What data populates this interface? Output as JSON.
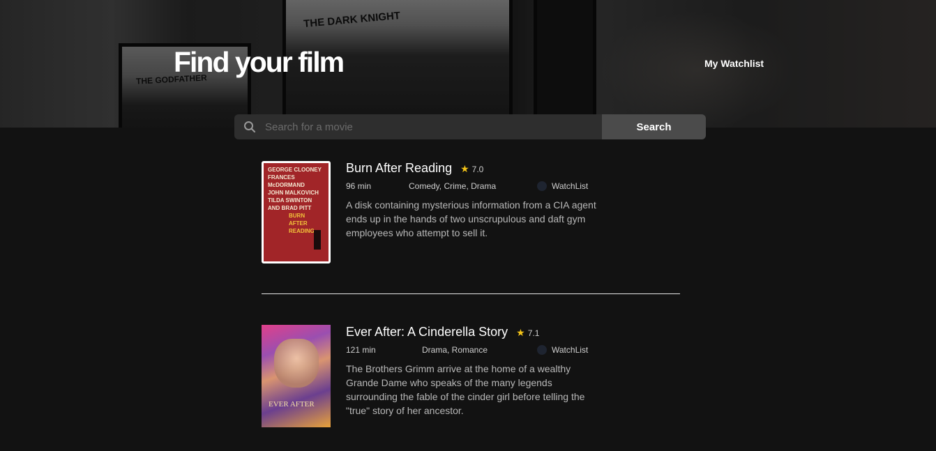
{
  "hero": {
    "title": "Find your film",
    "nav_link": "My Watchlist",
    "poster_texts": [
      "THE GODFATHER",
      "THE DARK KNIGHT"
    ]
  },
  "search": {
    "placeholder": "Search for a movie",
    "value": "",
    "button_label": "Search",
    "icon": "search-icon"
  },
  "movies": [
    {
      "title": "Burn After Reading",
      "rating": "7.0",
      "runtime": "96 min",
      "genres": "Comedy, Crime, Drama",
      "watchlist_label": "WatchList",
      "plot": "A disk containing mysterious information from a CIA agent ends up in the hands of two unscrupulous and daft gym employees who attempt to sell it.",
      "poster_lines": [
        "GEORGE CLOONEY",
        "FRANCES McDORMAND",
        "JOHN MALKOVICH",
        "TILDA SWINTON",
        "AND BRAD PITT",
        "BURN AFTER READING"
      ]
    },
    {
      "title": "Ever After: A Cinderella Story",
      "rating": "7.1",
      "runtime": "121 min",
      "genres": "Drama, Romance",
      "watchlist_label": "WatchList",
      "plot": "The Brothers Grimm arrive at the home of a wealthy Grande Dame who speaks of the many legends surrounding the fable of the cinder girl before telling the \"true\" story of her ancestor.",
      "poster_lines": [
        "EVER AFTER"
      ]
    }
  ],
  "colors": {
    "background": "#121212",
    "search_bar": "#2e2e2e",
    "search_button": "#4b4b4b",
    "star": "#f5c518"
  }
}
